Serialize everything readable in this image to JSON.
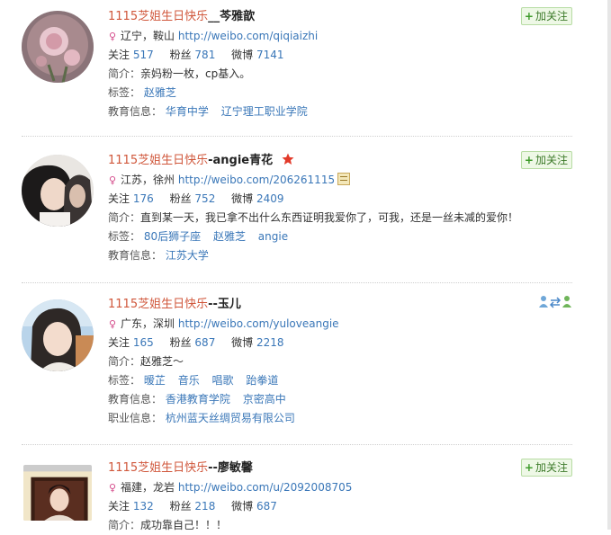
{
  "follow_label": "加关注",
  "labels": {
    "follow": "关注",
    "fans": "粉丝",
    "weibo": "微博",
    "intro": "简介：",
    "tags": "标签：",
    "edu": "教育信息：",
    "career": "职业信息："
  },
  "users": [
    {
      "name_prefix": "1115芝姐生日快乐",
      "name_main": "__芩雅歆",
      "location": "辽宁，鞍山",
      "url": "http://weibo.com/qiqiaizhi",
      "follow": "517",
      "fans": "781",
      "weibo": "7141",
      "intro": "亲妈粉一枚，cp基入。",
      "tags": [
        "赵雅芝"
      ],
      "edu": [
        "华育中学",
        "辽宁理工职业学院"
      ]
    },
    {
      "name_prefix": "1115芝姐生日快乐",
      "name_main": "-angie青花",
      "location": "江苏，徐州",
      "url": "http://weibo.com/206261115",
      "follow": "176",
      "fans": "752",
      "weibo": "2409",
      "intro": "直到某一天，我已拿不出什么东西证明我爱你了，可我，还是一丝未减的爱你！",
      "tags": [
        "80后狮子座",
        "赵雅芝",
        "angie"
      ],
      "edu": [
        "江苏大学"
      ]
    },
    {
      "name_prefix": "1115芝姐生日快乐",
      "name_main": "--玉儿",
      "location": "广东，深圳",
      "url": "http://weibo.com/yuloveangie",
      "follow": "165",
      "fans": "687",
      "weibo": "2218",
      "intro": "赵雅芝～",
      "tags": [
        "暧芷",
        "音乐",
        "唱歌",
        "跆拳道"
      ],
      "edu": [
        "香港教育学院",
        "京密高中"
      ],
      "career": [
        "杭州蓝天丝绸贸易有限公司"
      ]
    },
    {
      "name_prefix": "1115芝姐生日快乐",
      "name_main": "--廖敏馨",
      "location": "福建，龙岩",
      "url": "http://weibo.com/u/2092008705",
      "follow": "132",
      "fans": "218",
      "weibo": "687",
      "intro": "成功靠自己！！！"
    }
  ]
}
